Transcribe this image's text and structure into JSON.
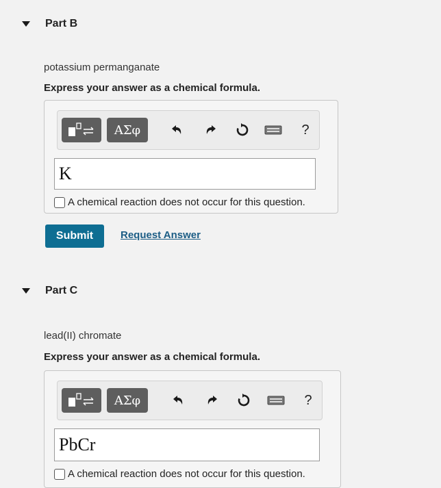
{
  "partB": {
    "title": "Part B",
    "compound": "potassium permanganate",
    "instruction": "Express your answer as a chemical formula.",
    "toolbar": {
      "greek": "ΑΣφ",
      "help": "?"
    },
    "input_value": "K",
    "no_reaction_label": "A chemical reaction does not occur for this question.",
    "submit_label": "Submit",
    "request_label": "Request Answer"
  },
  "partC": {
    "title": "Part C",
    "compound": "lead(II) chromate",
    "instruction": "Express your answer as a chemical formula.",
    "toolbar": {
      "greek": "ΑΣφ",
      "help": "?"
    },
    "input_value": "PbCr",
    "no_reaction_label": "A chemical reaction does not occur for this question."
  },
  "icons": [
    "caret-down-icon",
    "templates-icon",
    "undo-icon",
    "redo-icon",
    "reset-icon",
    "keyboard-icon",
    "help-icon"
  ],
  "colors": {
    "submit_bg": "#0e6e93",
    "link": "#1c5d85",
    "tool_btn": "#5e5e5e"
  }
}
